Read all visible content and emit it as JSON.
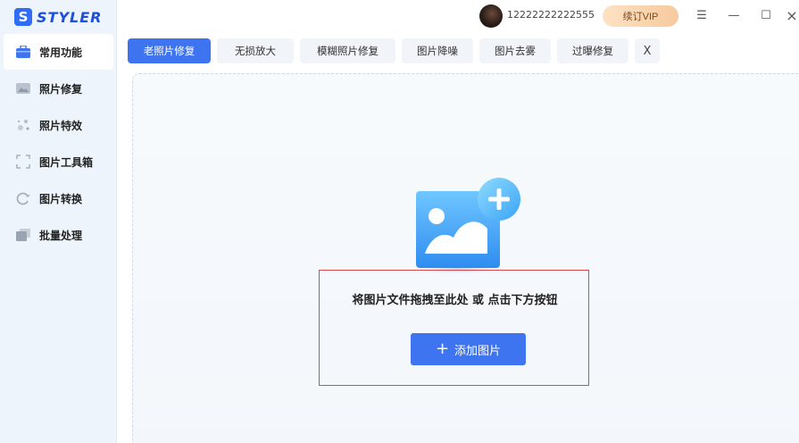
{
  "app": {
    "logo_letter": "S",
    "name": "STYLER"
  },
  "sidebar": {
    "items": [
      {
        "label": "常用功能",
        "icon": "toolbox-icon",
        "active": true
      },
      {
        "label": "照片修复",
        "icon": "photo-icon"
      },
      {
        "label": "照片特效",
        "icon": "sparkle-icon"
      },
      {
        "label": "图片工具箱",
        "icon": "crop-frame-icon"
      },
      {
        "label": "图片转换",
        "icon": "convert-icon"
      },
      {
        "label": "批量处理",
        "icon": "batch-icon"
      }
    ]
  },
  "titlebar": {
    "phone": "12222222222555",
    "vip_label": "续订VIP",
    "menu_glyph": "☰",
    "minimize_glyph": "—",
    "maximize_glyph": "☐",
    "close_glyph": "×"
  },
  "tabs": {
    "items": [
      {
        "label": "老照片修复",
        "active": true
      },
      {
        "label": "无损放大"
      },
      {
        "label": "模糊照片修复"
      },
      {
        "label": "图片降噪"
      },
      {
        "label": "图片去雾"
      },
      {
        "label": "过曝修复"
      }
    ],
    "close_glyph": "X"
  },
  "dropzone": {
    "hint": "将图片文件拖拽至此处 或 点击下方按钮",
    "add_label": "添加图片",
    "add_glyph": "+"
  },
  "colors": {
    "accent": "#3f74f0",
    "sidebar_bg": "#eef4fb",
    "vip_gradient_start": "#fde2c4",
    "vip_gradient_end": "#f7c99e",
    "highlight_border": "#e0474c"
  }
}
